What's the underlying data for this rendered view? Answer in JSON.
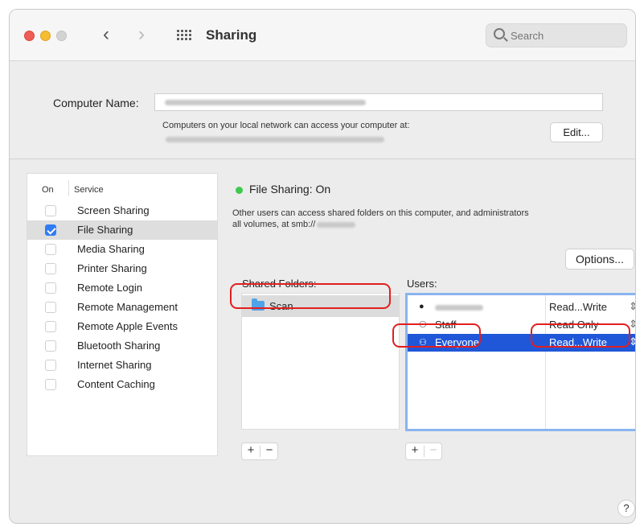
{
  "window": {
    "title": "Sharing",
    "search_placeholder": "Search"
  },
  "computer_name": {
    "label": "Computer Name:",
    "description": "Computers on your local network can access your computer at:",
    "edit_label": "Edit..."
  },
  "services": {
    "header_on": "On",
    "header_service": "Service",
    "items": [
      {
        "label": "Screen Sharing",
        "checked": false
      },
      {
        "label": "File Sharing",
        "checked": true
      },
      {
        "label": "Media Sharing",
        "checked": false
      },
      {
        "label": "Printer Sharing",
        "checked": false
      },
      {
        "label": "Remote Login",
        "checked": false
      },
      {
        "label": "Remote Management",
        "checked": false
      },
      {
        "label": "Remote Apple Events",
        "checked": false
      },
      {
        "label": "Bluetooth Sharing",
        "checked": false
      },
      {
        "label": "Internet Sharing",
        "checked": false
      },
      {
        "label": "Content Caching",
        "checked": false
      }
    ]
  },
  "status": {
    "label": "File Sharing: On",
    "color": "#3ec94f",
    "description_line1": "Other users can access shared folders on this computer, and administrators",
    "description_line2": "all volumes, at smb://"
  },
  "options_label": "Options...",
  "shared_folders": {
    "label": "Shared Folders:",
    "items": [
      {
        "name": "Scan",
        "icon": "folder-icon"
      }
    ]
  },
  "users": {
    "label": "Users:",
    "items": [
      {
        "icon": "person-icon",
        "name": "",
        "permission": "Read...Write"
      },
      {
        "icon": "group-icon",
        "name": "Staff",
        "permission": "Read Only"
      },
      {
        "icon": "group-icon",
        "name": "Everyone",
        "permission": "Read...Write"
      }
    ]
  },
  "controls": {
    "add": "+",
    "remove": "−",
    "help": "?"
  },
  "colors": {
    "accent": "#2f7cf6",
    "selection": "#2057d8",
    "annotation": "#e21f1f"
  }
}
